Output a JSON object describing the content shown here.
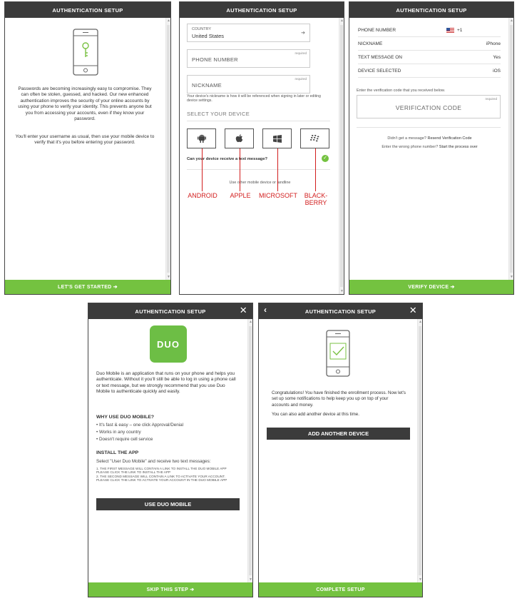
{
  "header_title": "AUTHENTICATION SETUP",
  "close_glyph": "✕",
  "back_glyph": "‹",
  "intro": {
    "paragraph1": "Passwords are becoming increasingly easy to compromise. They can often be stolen, guessed, and hacked. Our new enhanced authentication improves the security of your online accounts by using your phone to verify your identity. This prevents anyone but you from accessing your accounts, even if they know your password.",
    "paragraph2": "You'll enter your username as usual, then use your mobile device to verify that it's you before entering your password.",
    "footer": "LET'S GET STARTED  ➔"
  },
  "device_form": {
    "country_label": "COUNTRY",
    "country_value": "United States",
    "country_arrow": "➔",
    "phone_placeholder": "PHONE NUMBER",
    "nickname_placeholder": "NICKNAME",
    "required": "required",
    "nickname_help": "Your device's nickname is how it will be referenced when signing in later or editing device settings.",
    "select_device": "SELECT YOUR DEVICE",
    "text_question": "Can your device receive a text message?",
    "other_device": "Use other mobile device or landline",
    "annotations": [
      "ANDROID",
      "APPLE",
      "MICROSOFT",
      "BLACK-\nBERRY"
    ]
  },
  "verify": {
    "rows": [
      {
        "key": "PHONE NUMBER",
        "value": "+1"
      },
      {
        "key": "NICKNAME",
        "value": "iPhone"
      },
      {
        "key": "TEXT MESSAGE ON",
        "value": "Yes"
      },
      {
        "key": "DEVICE SELECTED",
        "value": "iOS"
      }
    ],
    "instruction": "Enter the verification code that you received below.",
    "required": "required",
    "code_placeholder": "VERIFICATION CODE",
    "no_message": "Didn't get a message?",
    "resend": "Resend Verification Code",
    "wrong_number": "Enter the wrong phone number?",
    "start_over": "Start the process over",
    "footer": "VERIFY DEVICE  ➔"
  },
  "duo": {
    "logo_text": "DUO",
    "intro": "Duo Mobile is an application that runs on your phone and helps you authenticate. Without it you'll still be able to log in using a phone call or text message, but we strongly recommend that you use Duo Mobile to authenticate quickly and easily.",
    "why_heading": "WHY USE DUO MOBILE?",
    "why_items": [
      "• It's fast & easy – one click Approval/Denial",
      "• Works in any country",
      "• Doesn't require cell service"
    ],
    "install_heading": "INSTALL THE APP",
    "install_intro": "Select \"User Duo Mobile\" and receive two text messages:",
    "step1": "1. THE FIRST MESSAGE WILL CONTAIN A LINK TO INSTALL THE DUO MOBILE APP PLEASE CLICK THE LINK TO INSTALL THE APP",
    "step2": "2. THE SECOND MESSAGE WILL CONTAIN A LINK TO ACTIVATE YOUR ACCOUNT. PLEASE CLICK THE LINK TO ACTIVATE YOUR ACCOUNT IN THE DUO MOBILE APP",
    "button": "USE DUO MOBILE",
    "footer": "SKIP THIS STEP  ➔"
  },
  "complete": {
    "line1": "Congratulations! You have finished the enrollment process. Now let's set up some notifications to help keep you up on top of your accounts and money.",
    "line2": "You can also add another device at this time.",
    "button": "ADD ANOTHER DEVICE",
    "footer": "COMPLETE SETUP"
  },
  "colors": {
    "accent_green": "#74c240",
    "header_dark": "#3b3b3b",
    "annotation_red": "#d21d1d"
  }
}
